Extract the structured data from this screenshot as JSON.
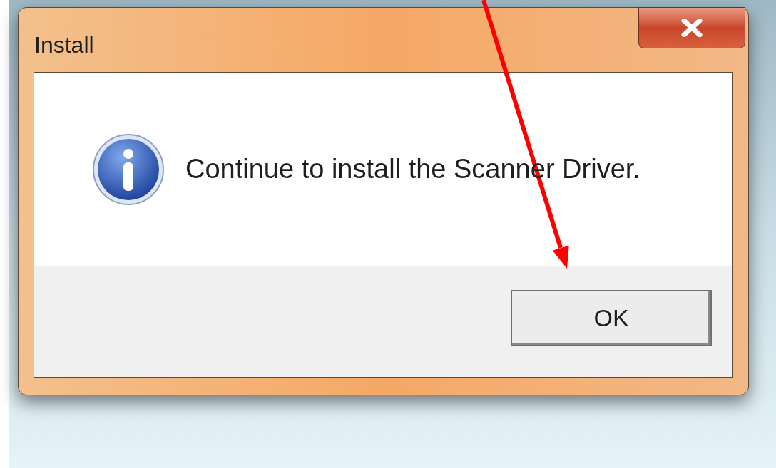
{
  "window": {
    "title": "Install"
  },
  "message": "Continue to install the Scanner Driver.",
  "buttons": [
    "OK"
  ]
}
